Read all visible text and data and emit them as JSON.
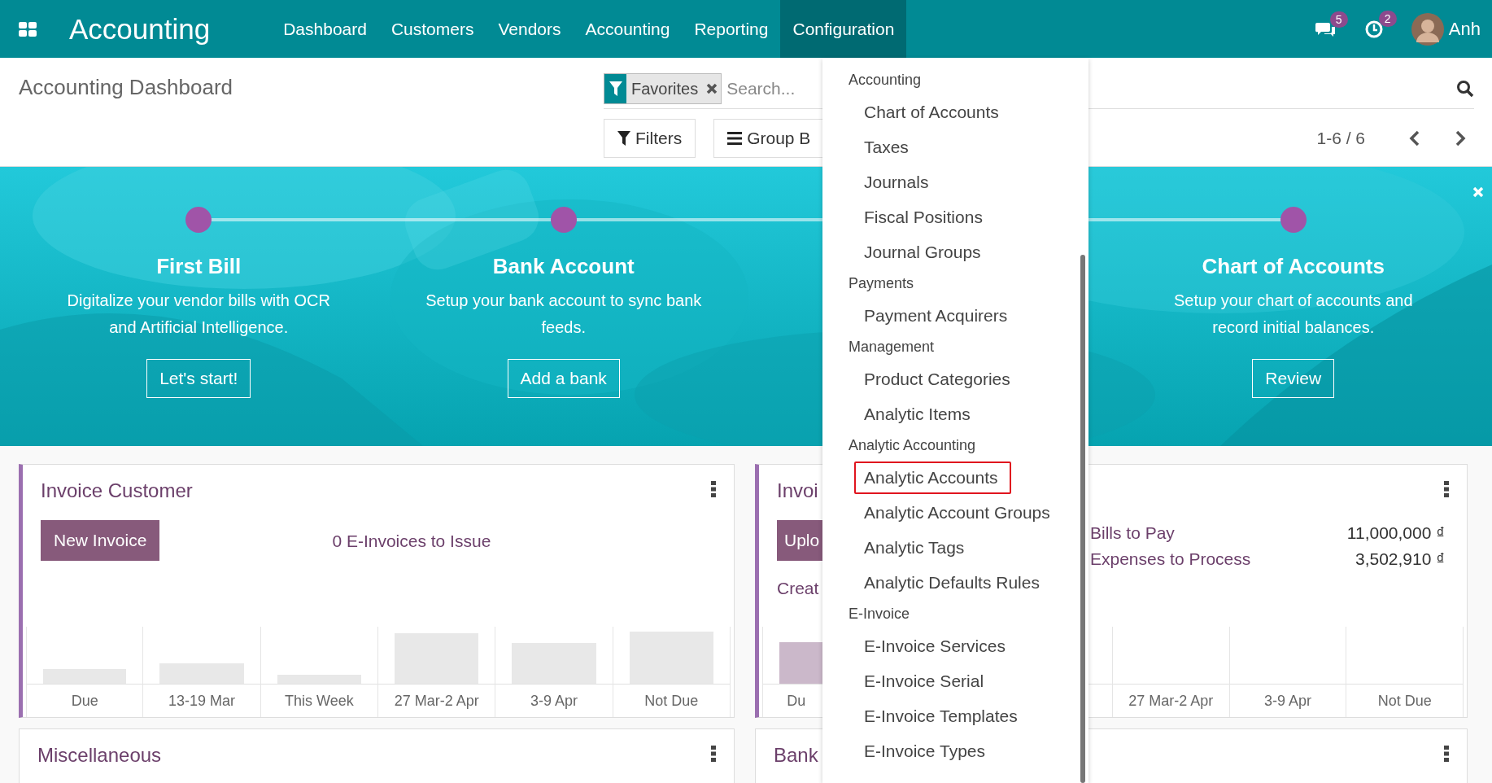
{
  "navbar": {
    "brand": "Accounting",
    "menu": [
      {
        "label": "Dashboard",
        "selected": false
      },
      {
        "label": "Customers",
        "selected": false
      },
      {
        "label": "Vendors",
        "selected": false
      },
      {
        "label": "Accounting",
        "selected": false
      },
      {
        "label": "Reporting",
        "selected": false
      },
      {
        "label": "Configuration",
        "selected": true
      }
    ],
    "messages_badge": "5",
    "activities_badge": "2",
    "user": "Anh"
  },
  "control_panel": {
    "title": "Accounting Dashboard",
    "search": {
      "facet": "Favorites",
      "placeholder": "Search..."
    },
    "buttons": [
      "Filters",
      "Group B"
    ],
    "pager": "1-6 / 6"
  },
  "banner": {
    "steps": [
      {
        "title": "First Bill",
        "description": "Digitalize your vendor bills with OCR and Artificial Intelligence.",
        "button": "Let's start!"
      },
      {
        "title": "Bank Account",
        "description": "Setup your bank account to sync bank feeds.",
        "button": "Add a bank"
      },
      {
        "title": "Chart of Accounts",
        "description": "Setup your chart of accounts and record initial balances.",
        "button": "Review"
      }
    ]
  },
  "cards": [
    {
      "kind": "sales",
      "title": "Invoice Customer",
      "action": "New Invoice",
      "link": "0 E-Invoices to Issue",
      "chart_labels": [
        "Due",
        "13-19 Mar",
        "This Week",
        "27 Mar-2 Apr",
        "3-9 Apr",
        "Not Due"
      ]
    },
    {
      "kind": "purchase",
      "title": "Invoi",
      "action": "Uplo",
      "link": "Creat",
      "summary": [
        {
          "label": "Bills to Pay",
          "amount": "11,000,000 ₫"
        },
        {
          "label": "Expenses to Process",
          "amount": "3,502,910 ₫"
        }
      ],
      "chart_labels": [
        "Du",
        "27 Mar-2 Apr",
        "3-9 Apr",
        "Not Due"
      ]
    },
    {
      "kind": "plain",
      "title": "Miscellaneous"
    },
    {
      "kind": "plain",
      "title": "Bank"
    }
  ],
  "dropdown": {
    "items": [
      {
        "kind": "header",
        "label": "Accounting"
      },
      {
        "kind": "item",
        "label": "Chart of Accounts",
        "highlighted": false
      },
      {
        "kind": "item",
        "label": "Taxes",
        "highlighted": false
      },
      {
        "kind": "item",
        "label": "Journals",
        "highlighted": false
      },
      {
        "kind": "item",
        "label": "Fiscal Positions",
        "highlighted": false
      },
      {
        "kind": "item",
        "label": "Journal Groups",
        "highlighted": false
      },
      {
        "kind": "header",
        "label": "Payments"
      },
      {
        "kind": "item",
        "label": "Payment Acquirers",
        "highlighted": false
      },
      {
        "kind": "header",
        "label": "Management"
      },
      {
        "kind": "item",
        "label": "Product Categories",
        "highlighted": false
      },
      {
        "kind": "item",
        "label": "Analytic Items",
        "highlighted": false
      },
      {
        "kind": "header",
        "label": "Analytic Accounting"
      },
      {
        "kind": "item",
        "label": "Analytic Accounts",
        "highlighted": true
      },
      {
        "kind": "item",
        "label": "Analytic Account Groups",
        "highlighted": false
      },
      {
        "kind": "item",
        "label": "Analytic Tags",
        "highlighted": false
      },
      {
        "kind": "item",
        "label": "Analytic Defaults Rules",
        "highlighted": false
      },
      {
        "kind": "header",
        "label": "E-Invoice"
      },
      {
        "kind": "item",
        "label": "E-Invoice Services",
        "highlighted": false
      },
      {
        "kind": "item",
        "label": "E-Invoice Serial",
        "highlighted": false
      },
      {
        "kind": "item",
        "label": "E-Invoice Templates",
        "highlighted": false
      },
      {
        "kind": "item",
        "label": "E-Invoice Types",
        "highlighted": false
      }
    ]
  }
}
